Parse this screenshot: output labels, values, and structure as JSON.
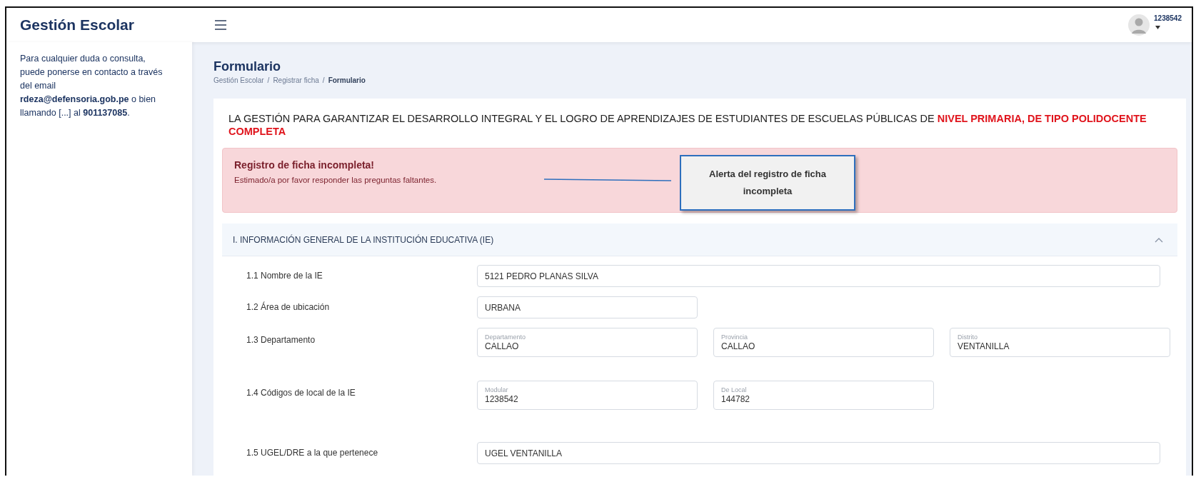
{
  "header": {
    "title": "Gestión Escolar",
    "user": "1238542"
  },
  "sidebar": {
    "text": "Para cualquier duda o consulta, puede ponerse en contacto a través del email **rdeza@defensoria.gob.pe** o bien llamando [...] al **901137085**."
  },
  "page": {
    "title": "Formulario",
    "breadcrumb": [
      {
        "label": "Gestión Escolar",
        "current": false
      },
      {
        "label": "Registrar ficha",
        "current": false
      },
      {
        "label": "Formulario",
        "current": true
      }
    ],
    "separator": "/"
  },
  "card": {
    "heading": "LA GESTIÓN PARA GARANTIZAR EL DESARROLLO INTEGRAL Y EL LOGRO DE APRENDIZAJES DE ESTUDIANTES DE ESCUELAS PÚBLICAS DE **NIVEL PRIMARIA, DE TIPO POLIDOCENTE COMPLETA**"
  },
  "alert": {
    "title": "Registro de ficha incompleta!",
    "message": "Estimado/a por favor responder las preguntas faltantes."
  },
  "callout": {
    "text": "Alerta del registro de ficha incompleta"
  },
  "section": {
    "title": "I. INFORMACIÓN GENERAL DE LA INSTITUCIÓN EDUCATIVA (IE)",
    "expanded": true,
    "rows": [
      {
        "label": "1.1 Nombre de la IE",
        "kind": "wide",
        "inputs": [
          {
            "value": "5121 PEDRO PLANAS SILVA"
          }
        ]
      },
      {
        "label": "1.2 Área de ubicación",
        "kind": "short",
        "inputs": [
          {
            "value": "URBANA"
          }
        ]
      },
      {
        "label": "1.3 Departamento",
        "kind": "labeled",
        "inputs": [
          {
            "caption": "Departamento",
            "value": "CALLAO"
          },
          {
            "caption": "Provincia",
            "value": "CALLAO"
          },
          {
            "caption": "Distrito",
            "value": "VENTANILLA"
          }
        ]
      },
      {
        "label": "1.4 Códigos de local de la IE",
        "kind": "labeled",
        "inputs": [
          {
            "caption": "Modular",
            "value": "1238542"
          },
          {
            "caption": "De Local",
            "value": "144782"
          }
        ]
      },
      {
        "label": "1.5 UGEL/DRE a la que pertenece",
        "kind": "wide",
        "inputs": [
          {
            "value": "UGEL VENTANILLA"
          }
        ]
      }
    ]
  }
}
